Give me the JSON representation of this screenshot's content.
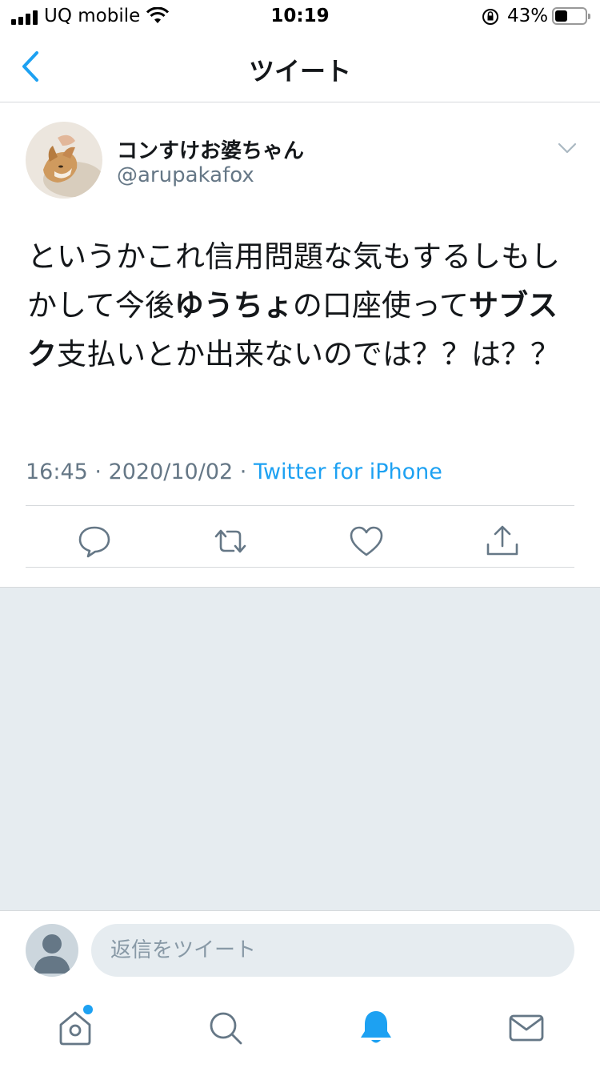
{
  "status_bar": {
    "carrier": "UQ mobile",
    "time": "10:19",
    "battery_percent": "43%",
    "battery_level": 0.43,
    "signal_bars": 4
  },
  "nav": {
    "title": "ツイート",
    "back_icon": "chevron-left-icon"
  },
  "tweet": {
    "display_name": "コンすけお婆ちゃん",
    "handle": "@arupakafox",
    "text_segments": [
      {
        "text": "というかこれ信用問題な気もするしもしかして今後",
        "bold": false
      },
      {
        "text": "ゆうちょ",
        "bold": true
      },
      {
        "text": "の口座使って",
        "bold": false
      },
      {
        "text": "サブスク",
        "bold": true
      },
      {
        "text": "支払いとか出来ないのでは？？は？？",
        "bold": false
      }
    ],
    "time": "16:45",
    "date": "2020/10/02",
    "separator": " · ",
    "source": "Twitter for iPhone",
    "actions": [
      "reply-icon",
      "retweet-icon",
      "like-icon",
      "share-icon"
    ]
  },
  "reply_bar": {
    "placeholder": "返信をツイート"
  },
  "tab_bar": {
    "tabs": [
      "home-icon",
      "search-icon",
      "notifications-icon",
      "messages-icon"
    ],
    "active": "notifications-icon"
  },
  "colors": {
    "accent": "#1da1f2",
    "text": "#14171a",
    "secondary": "#657786",
    "divider": "#d6d9dc",
    "background_gray": "#e6ecf0"
  }
}
